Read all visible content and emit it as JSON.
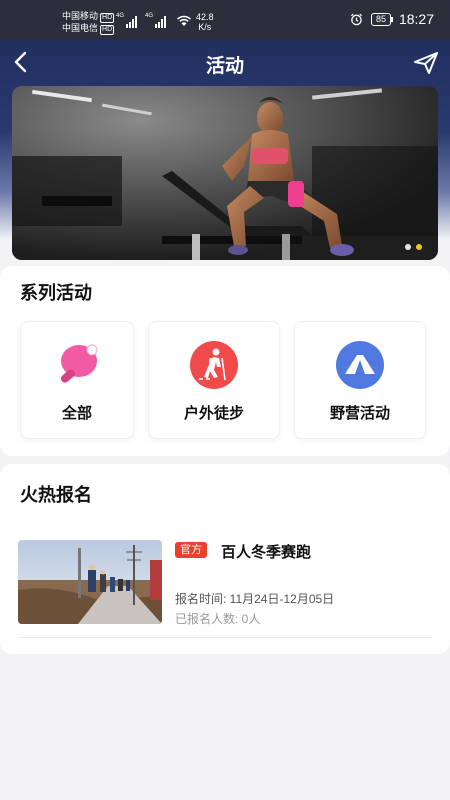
{
  "statusbar": {
    "carrier1": "中国移动",
    "carrier2": "中国电信",
    "hd": "HD",
    "net1": "4G",
    "net2": "4G",
    "speed_value": "42.8",
    "speed_unit": "K/s",
    "battery": "85",
    "time": "18:27"
  },
  "nav": {
    "title": "活动"
  },
  "banner": {
    "slide_count": 2,
    "active_slide": 2
  },
  "series": {
    "title": "系列活动",
    "items": [
      {
        "label": "全部",
        "icon": "ping-pong-icon",
        "color": "#f25ba4"
      },
      {
        "label": "户外徒步",
        "icon": "hiking-icon",
        "color": "#f04a4a"
      },
      {
        "label": "野营活动",
        "icon": "tent-icon",
        "color": "#4f79e0"
      }
    ]
  },
  "hot": {
    "title": "火热报名",
    "events": [
      {
        "tag": "官方",
        "title": "百人冬季赛跑",
        "time": "报名时间: 11月24日-12月05日",
        "count": "已报名人数: 0人"
      }
    ]
  },
  "colors": {
    "header": "#1d2b58",
    "accent_dot": "#f2c618",
    "tag": "#e8412f"
  }
}
